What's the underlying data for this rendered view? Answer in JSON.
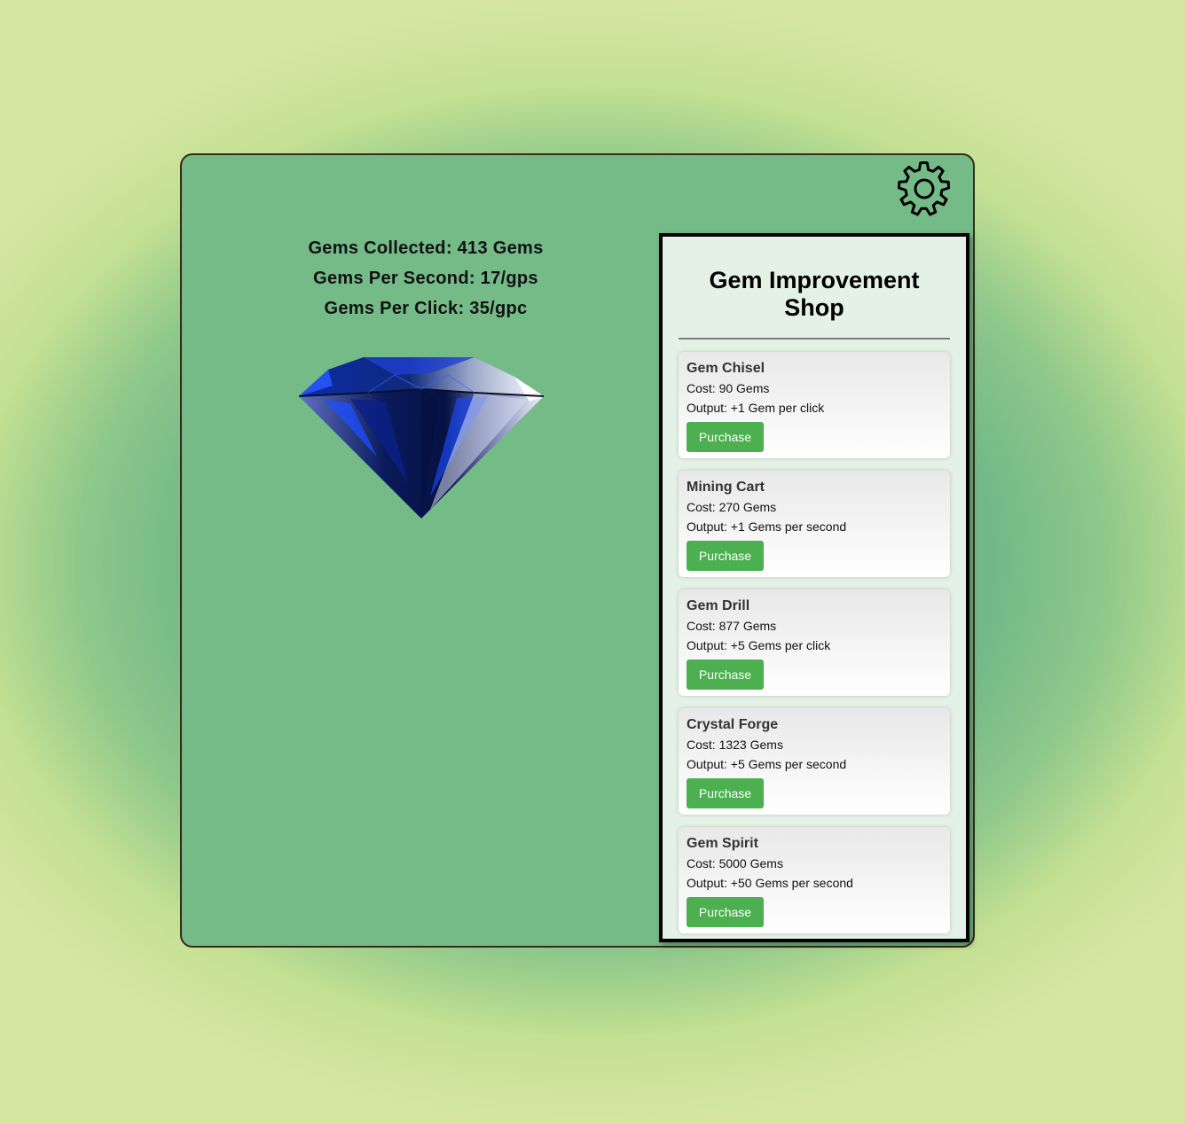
{
  "stats": {
    "gems_collected": "Gems Collected: 413 Gems",
    "gems_per_second": "Gems Per Second: 17/gps",
    "gems_per_click": "Gems Per Click: 35/gpc"
  },
  "settings": {
    "icon": "gear-icon"
  },
  "gem": {
    "icon": "blue-diamond-gem",
    "color": "#1a3fb8"
  },
  "shop": {
    "title": "Gem Improvement Shop",
    "items": [
      {
        "name": "Gem Chisel",
        "cost": "Cost: 90 Gems",
        "output": "Output: +1 Gem per click",
        "button": "Purchase"
      },
      {
        "name": "Mining Cart",
        "cost": "Cost: 270 Gems",
        "output": "Output: +1 Gems per second",
        "button": "Purchase"
      },
      {
        "name": "Gem Drill",
        "cost": "Cost: 877 Gems",
        "output": "Output: +5 Gems per click",
        "button": "Purchase"
      },
      {
        "name": "Crystal Forge",
        "cost": "Cost: 1323 Gems",
        "output": "Output: +5 Gems per second",
        "button": "Purchase"
      },
      {
        "name": "Gem Spirit",
        "cost": "Cost: 5000 Gems",
        "output": "Output: +50 Gems per second",
        "button": "Purchase"
      }
    ]
  },
  "colors": {
    "panel_green": "#74bb88",
    "shop_bg": "#e4f1e6",
    "button_green": "#4caf50"
  }
}
